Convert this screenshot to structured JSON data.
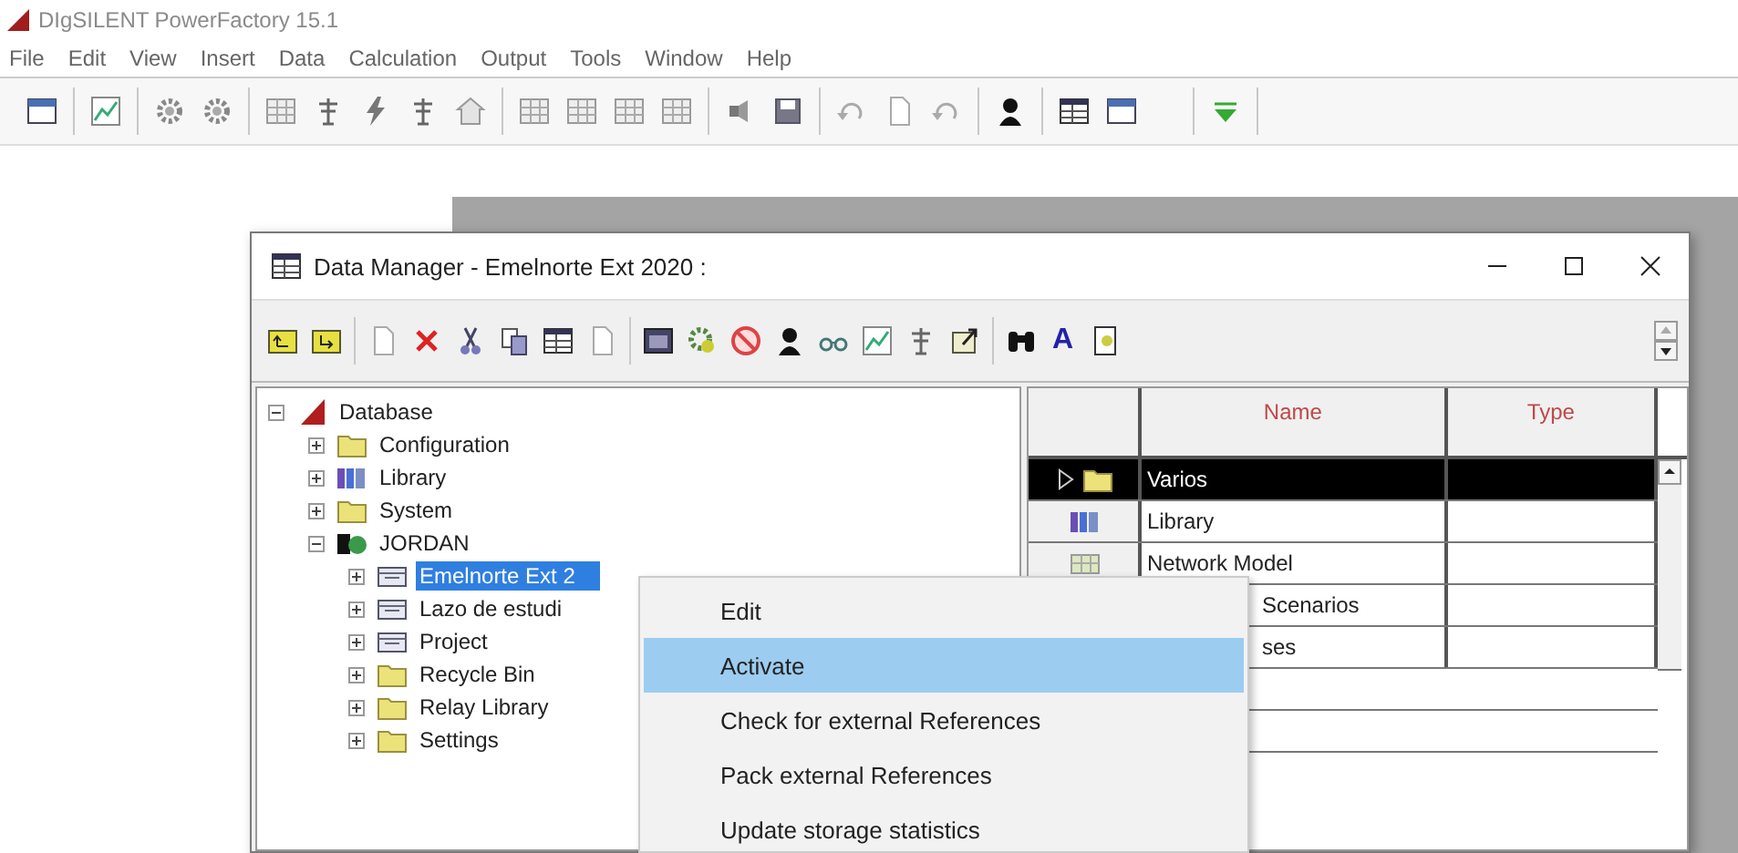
{
  "app": {
    "title": "DIgSILENT PowerFactory 15.1",
    "menu": [
      "File",
      "Edit",
      "View",
      "Insert",
      "Data",
      "Calculation",
      "Output",
      "Tools",
      "Window",
      "Help"
    ]
  },
  "data_manager": {
    "title": "Data Manager - Emelnorte Ext 2020 :",
    "toolbar_font_button": "A",
    "tree": [
      {
        "label": "Database",
        "kind": "database",
        "expanded": true,
        "selected": false,
        "children": [
          {
            "label": "Configuration",
            "kind": "folder",
            "expanded": false,
            "selected": false
          },
          {
            "label": "Library",
            "kind": "library",
            "expanded": false,
            "selected": false
          },
          {
            "label": "System",
            "kind": "folder",
            "expanded": false,
            "selected": false
          },
          {
            "label": "JORDAN",
            "kind": "user",
            "expanded": true,
            "selected": false,
            "children": [
              {
                "label": "Emelnorte Ext 2",
                "kind": "project",
                "expanded": false,
                "selected": true
              },
              {
                "label": "Lazo de estudi",
                "kind": "project",
                "expanded": false,
                "selected": false
              },
              {
                "label": "Project",
                "kind": "project",
                "expanded": false,
                "selected": false
              },
              {
                "label": "Recycle Bin",
                "kind": "folder",
                "expanded": false,
                "selected": false
              },
              {
                "label": "Relay Library",
                "kind": "folder",
                "expanded": false,
                "selected": false
              },
              {
                "label": "Settings",
                "kind": "folder",
                "expanded": false,
                "selected": false
              }
            ]
          }
        ]
      }
    ],
    "list": {
      "columns": [
        "Name",
        "Type"
      ],
      "rows": [
        {
          "name": "Varios",
          "kind": "folder",
          "selected": true
        },
        {
          "name": "Library",
          "kind": "library",
          "selected": false
        },
        {
          "name": "Network Model",
          "kind": "grid",
          "selected": false
        },
        {
          "name": "Scenarios",
          "kind": "covered",
          "selected": false
        },
        {
          "name": "ses",
          "kind": "covered",
          "selected": false
        }
      ]
    }
  },
  "context_menu": [
    {
      "label": "Edit",
      "selected": false
    },
    {
      "label": "Activate",
      "selected": true
    },
    {
      "label": "Check for external References",
      "selected": false
    },
    {
      "label": "Pack external References",
      "selected": false
    },
    {
      "label": "Update storage statistics",
      "selected": false
    }
  ]
}
